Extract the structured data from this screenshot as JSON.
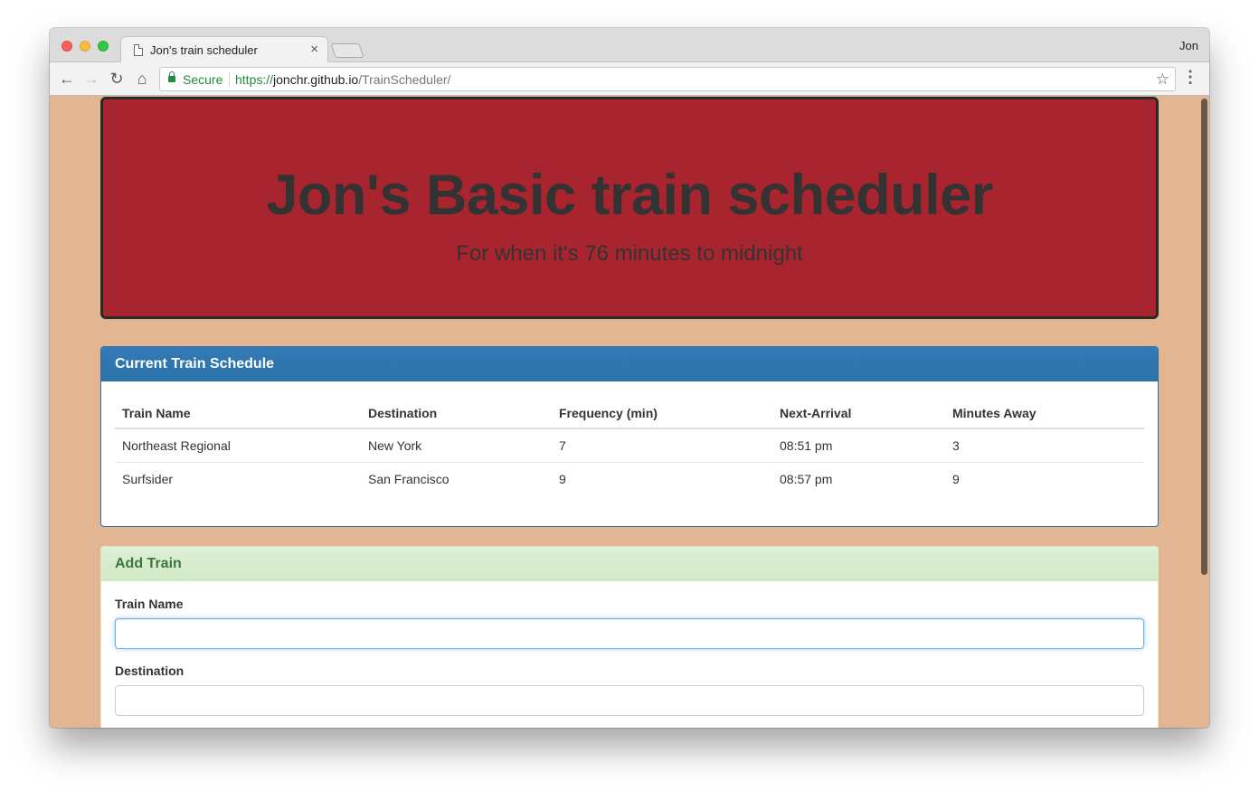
{
  "browser": {
    "tab_title": "Jon's train scheduler",
    "tab_close": "×",
    "profile_name": "Jon",
    "secure_label": "Secure",
    "url_scheme": "https://",
    "url_host": "jonchr.github.io",
    "url_path": "/TrainScheduler/",
    "icons": {
      "back": "←",
      "forward": "→",
      "reload": "↻",
      "home": "⌂",
      "star": "☆",
      "menu": "⋮"
    }
  },
  "jumbotron": {
    "title": "Jon's Basic train scheduler",
    "subtitle": "For when it's 76 minutes to midnight",
    "background_color": "#a8242e"
  },
  "schedule_panel": {
    "heading": "Current Train Schedule",
    "columns": [
      "Train Name",
      "Destination",
      "Frequency (min)",
      "Next-Arrival",
      "Minutes Away"
    ],
    "rows": [
      [
        "Northeast Regional",
        "New York",
        "7",
        "08:51 pm",
        "3"
      ],
      [
        "Surfsider",
        "San Francisco",
        "9",
        "08:57 pm",
        "9"
      ]
    ],
    "accent_color": "#337ab7"
  },
  "add_panel": {
    "heading": "Add Train",
    "fields": [
      {
        "label": "Train Name",
        "value": "",
        "focused": true
      },
      {
        "label": "Destination",
        "value": "",
        "focused": false
      }
    ],
    "accent_color": "#3c763d"
  },
  "page_background": "#e2b693"
}
